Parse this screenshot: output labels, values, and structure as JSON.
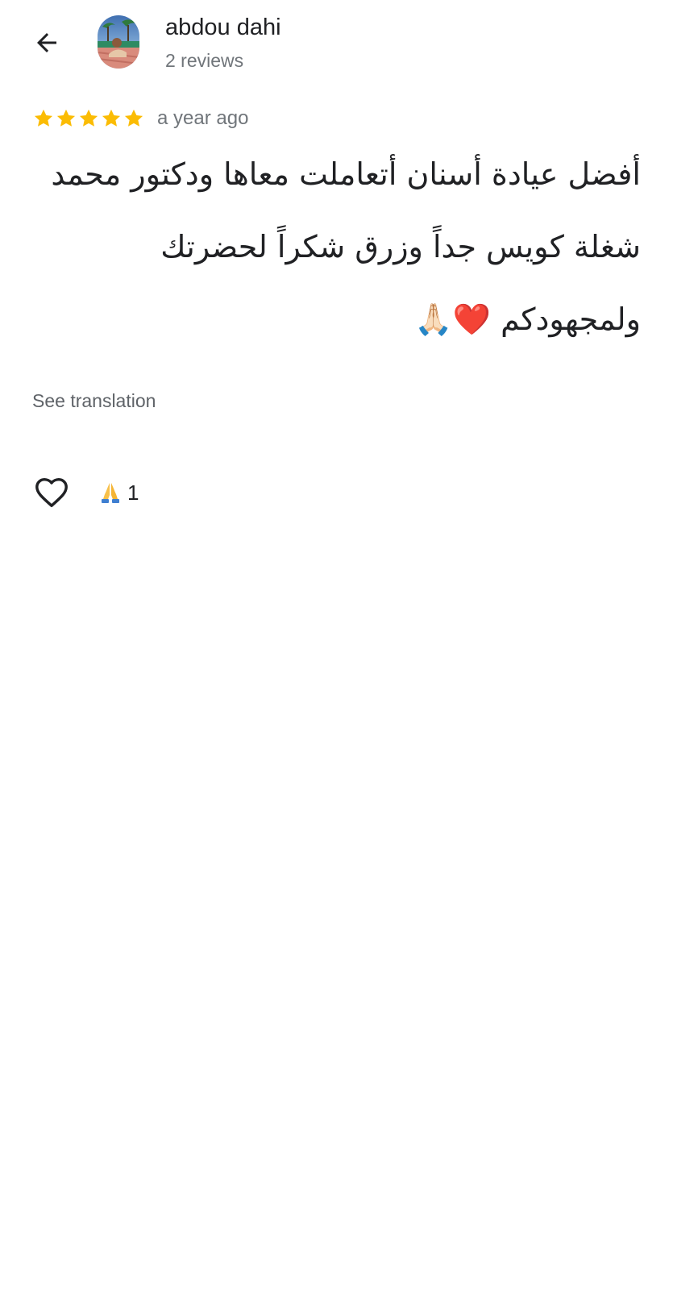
{
  "header": {
    "back_icon": "arrow-left-icon",
    "author_name": "abdou dahi",
    "author_reviews": "2 reviews"
  },
  "review": {
    "rating": 5,
    "rating_max": 5,
    "star_color": "#fbbc04",
    "timestamp": "a year ago",
    "text": "أفضل عيادة أسنان أتعاملت معاها ودكتور محمد شغلة كويس جداً وزرق شكراً لحضرتك ولمجهودكم ❤️🙏🏻",
    "see_translation_label": "See translation"
  },
  "actions": {
    "like_icon": "heart-outline-icon",
    "reaction_icon": "folded-hands-icon",
    "reaction_count": "1"
  }
}
